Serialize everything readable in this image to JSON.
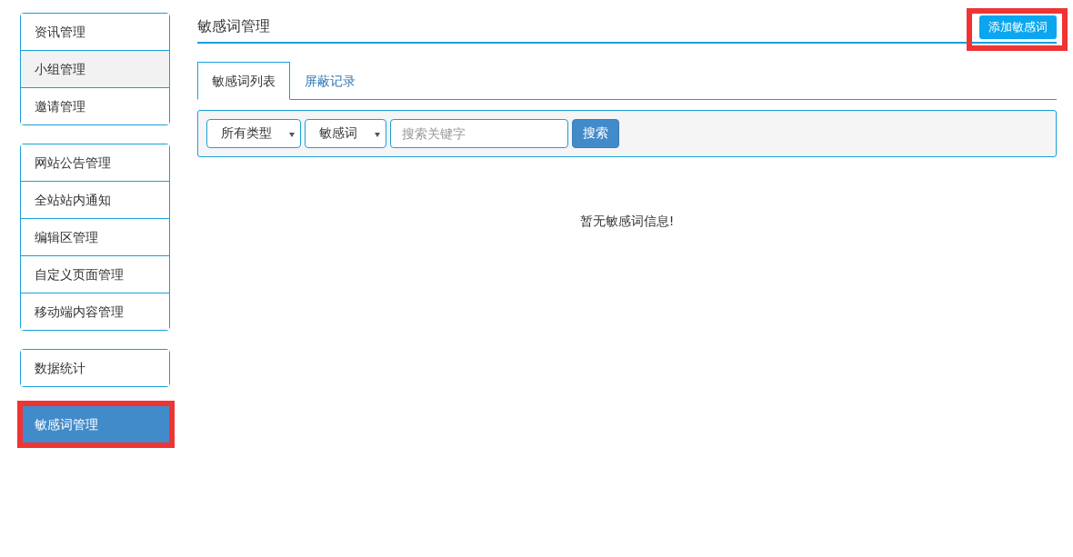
{
  "sidebar": {
    "groups": [
      {
        "items": [
          {
            "label": "资讯管理",
            "selected": false,
            "hovered": false,
            "highlighted": false
          },
          {
            "label": "小组管理",
            "selected": false,
            "hovered": true,
            "highlighted": false
          },
          {
            "label": "邀请管理",
            "selected": false,
            "hovered": false,
            "highlighted": false
          }
        ]
      },
      {
        "items": [
          {
            "label": "网站公告管理",
            "selected": false,
            "hovered": false,
            "highlighted": false
          },
          {
            "label": "全站站内通知",
            "selected": false,
            "hovered": false,
            "highlighted": false
          },
          {
            "label": "编辑区管理",
            "selected": false,
            "hovered": false,
            "highlighted": false
          },
          {
            "label": "自定义页面管理",
            "selected": false,
            "hovered": false,
            "highlighted": false
          },
          {
            "label": "移动端内容管理",
            "selected": false,
            "hovered": false,
            "highlighted": false
          }
        ]
      },
      {
        "items": [
          {
            "label": "数据统计",
            "selected": false,
            "hovered": false,
            "highlighted": false
          }
        ]
      },
      {
        "items": [
          {
            "label": "敏感词管理",
            "selected": true,
            "hovered": false,
            "highlighted": true
          }
        ]
      }
    ]
  },
  "page": {
    "title": "敏感词管理",
    "add_button": {
      "label": "添加敏感词",
      "highlighted": true
    }
  },
  "tabs": [
    {
      "label": "敏感词列表",
      "selected": true
    },
    {
      "label": "屏蔽记录",
      "selected": false
    }
  ],
  "filters": {
    "type_select": "所有类型",
    "field_select": "敏感词",
    "search": {
      "placeholder": "搜索关键字"
    },
    "search_button": "搜索"
  },
  "empty_message": "暂无敏感词信息!"
}
